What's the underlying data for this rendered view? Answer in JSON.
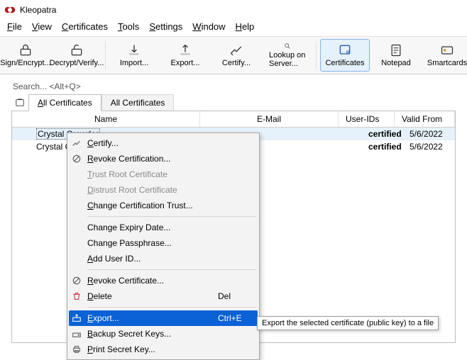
{
  "app": {
    "title": "Kleopatra"
  },
  "menubar": [
    {
      "pre": "",
      "u": "F",
      "post": "ile"
    },
    {
      "pre": "",
      "u": "V",
      "post": "iew"
    },
    {
      "pre": "",
      "u": "C",
      "post": "ertificates"
    },
    {
      "pre": "",
      "u": "T",
      "post": "ools"
    },
    {
      "pre": "",
      "u": "S",
      "post": "ettings"
    },
    {
      "pre": "",
      "u": "W",
      "post": "indow"
    },
    {
      "pre": "",
      "u": "H",
      "post": "elp"
    }
  ],
  "toolbar": {
    "sign": "Sign/Encrypt...",
    "decrypt": "Decrypt/Verify...",
    "import": "Import...",
    "export": "Export...",
    "certify": "Certify...",
    "lookup": "Lookup on Server...",
    "certificates": "Certificates",
    "notepad": "Notepad",
    "smartcards": "Smartcards"
  },
  "search": {
    "placeholder": "Search... <Alt+Q>"
  },
  "tabs": {
    "tab1": {
      "pre": "",
      "u": "A",
      "post": "ll Certificates"
    },
    "tab2": {
      "label": "All Certificates"
    }
  },
  "columns": {
    "name": "Name",
    "email": "E-Mail",
    "uid": "User-IDs",
    "valid": "Valid From"
  },
  "rows": [
    {
      "name": "Crystal Crowder",
      "uid": "certified",
      "valid": "5/6/2022"
    },
    {
      "name": "Crystal C",
      "uid": "certified",
      "valid": "5/6/2022"
    }
  ],
  "ctx": {
    "certify": {
      "pre": "",
      "u": "C",
      "post": "ertify..."
    },
    "revokeCert": {
      "pre": "",
      "u": "R",
      "post": "evoke Certification..."
    },
    "trustRoot": {
      "pre": "",
      "u": "T",
      "post": "rust Root Certificate"
    },
    "distrustRoot": {
      "pre": "",
      "u": "D",
      "post": "istrust Root Certificate"
    },
    "changeTrust": {
      "pre": "",
      "u": "C",
      "post": "hange Certification Trust..."
    },
    "changeExpiry": {
      "pre": "Change Expiry Date...",
      "u": "",
      "post": ""
    },
    "changePass": {
      "pre": "Change Passphrase...",
      "u": "",
      "post": ""
    },
    "addUid": {
      "pre": "",
      "u": "A",
      "post": "dd User ID..."
    },
    "revokeCertificate": {
      "pre": "",
      "u": "R",
      "post": "evoke Certificate..."
    },
    "delete": {
      "pre": "",
      "u": "D",
      "post": "elete",
      "accel": "Del"
    },
    "export": {
      "pre": "",
      "u": "E",
      "post": "xport...",
      "accel": "Ctrl+E"
    },
    "backup": {
      "pre": "",
      "u": "B",
      "post": "ackup Secret Keys..."
    },
    "print": {
      "pre": "",
      "u": "P",
      "post": "rint Secret Key..."
    }
  },
  "tooltip": "Export the selected certificate (public key) to a file"
}
